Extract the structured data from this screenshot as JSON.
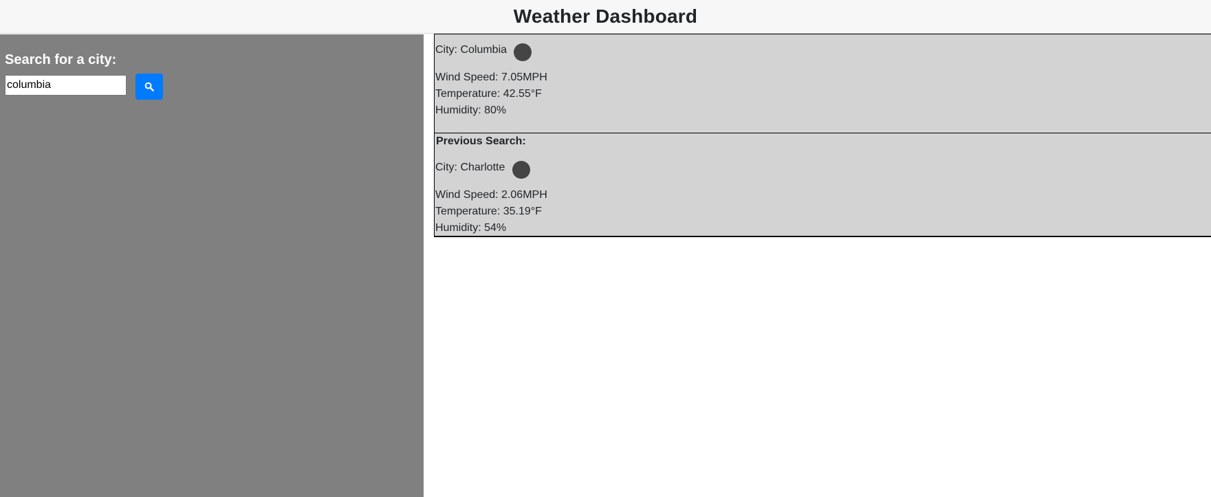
{
  "header": {
    "title": "Weather Dashboard"
  },
  "sidebar": {
    "search_label": "Search for a city:",
    "search_value": "columbia",
    "search_button_icon": "search-icon"
  },
  "current": {
    "city": "City: Columbia",
    "icon": "weather-icon",
    "wind": "Wind Speed: 7.05MPH",
    "temperature": "Temperature: 42.55°F",
    "humidity": "Humidity: 80%"
  },
  "previous": {
    "heading": "Previous Search:",
    "city": "City: Charlotte",
    "icon": "weather-icon",
    "wind": "Wind Speed: 2.06MPH",
    "temperature": "Temperature: 35.19°F",
    "humidity": "Humidity: 54%"
  },
  "colors": {
    "sidebar_bg": "#808080",
    "card_bg": "#d3d3d3",
    "button_bg": "#007bff",
    "header_bg": "#f7f7f7"
  }
}
